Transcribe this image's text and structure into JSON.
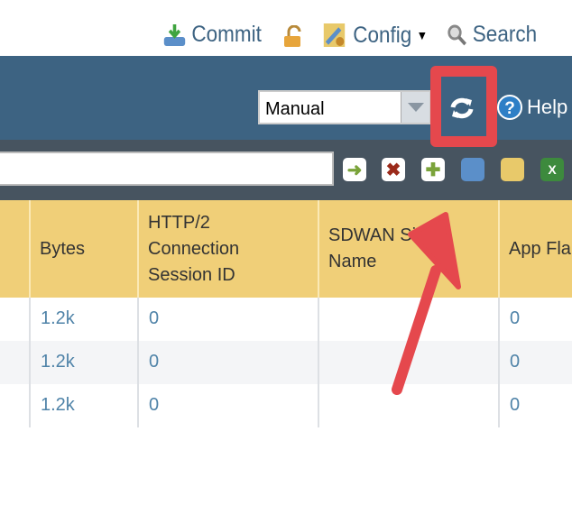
{
  "header": {
    "commit_label": "Commit",
    "config_label": "Config",
    "search_label": "Search"
  },
  "toolbar": {
    "mode_select": "Manual",
    "help_label": "Help",
    "filter_value": ""
  },
  "table": {
    "columns": [
      "Bytes",
      "HTTP/2\nConnection\nSession ID",
      "SDWAN Site\nName",
      "App Flap"
    ],
    "rows": [
      [
        "1.2k",
        "0",
        "",
        "0"
      ],
      [
        "1.2k",
        "0",
        "",
        "0"
      ],
      [
        "1.2k",
        "0",
        "",
        "0"
      ]
    ]
  },
  "colors": {
    "accent": "#3d6382",
    "header_bg": "#f0cf78",
    "annotation": "#e5484d"
  }
}
